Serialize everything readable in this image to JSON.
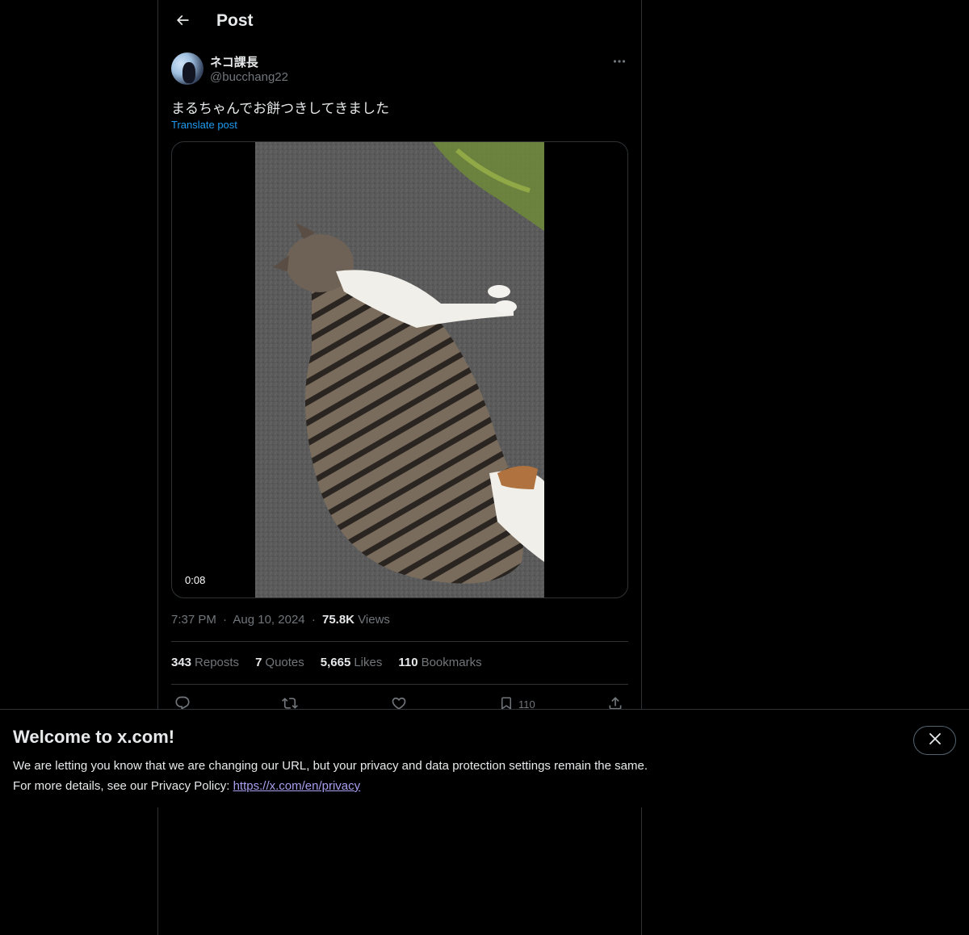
{
  "header": {
    "title": "Post"
  },
  "author": {
    "display_name": "ネコ課長",
    "handle": "@bucchang22"
  },
  "post": {
    "text": "まるちゃんでお餅つきしてきました",
    "translate_label": "Translate post",
    "video_duration": "0:08",
    "time": "7:37 PM",
    "date": "Aug 10, 2024",
    "separator": "·",
    "views_count": "75.8K",
    "views_label": "Views"
  },
  "stats": [
    {
      "count": "343",
      "label": "Reposts"
    },
    {
      "count": "7",
      "label": "Quotes"
    },
    {
      "count": "5,665",
      "label": "Likes"
    },
    {
      "count": "110",
      "label": "Bookmarks"
    }
  ],
  "actions": {
    "icons": [
      "reply-icon",
      "repost-icon",
      "like-icon",
      "bookmark-icon",
      "share-icon"
    ],
    "bookmark_count": "110"
  },
  "banner": {
    "title": "Welcome to x.com!",
    "line1": "We are letting you know that we are changing our URL, but your privacy and data protection settings remain the same.",
    "line2_prefix": "For more details, see our Privacy Policy: ",
    "link_text": "https://x.com/en/privacy"
  },
  "colors": {
    "background": "#000000",
    "text": "#e7e9ea",
    "muted": "#71767b",
    "accent": "#1d9bf0",
    "border": "#2f3336",
    "link": "#a99ff0"
  }
}
